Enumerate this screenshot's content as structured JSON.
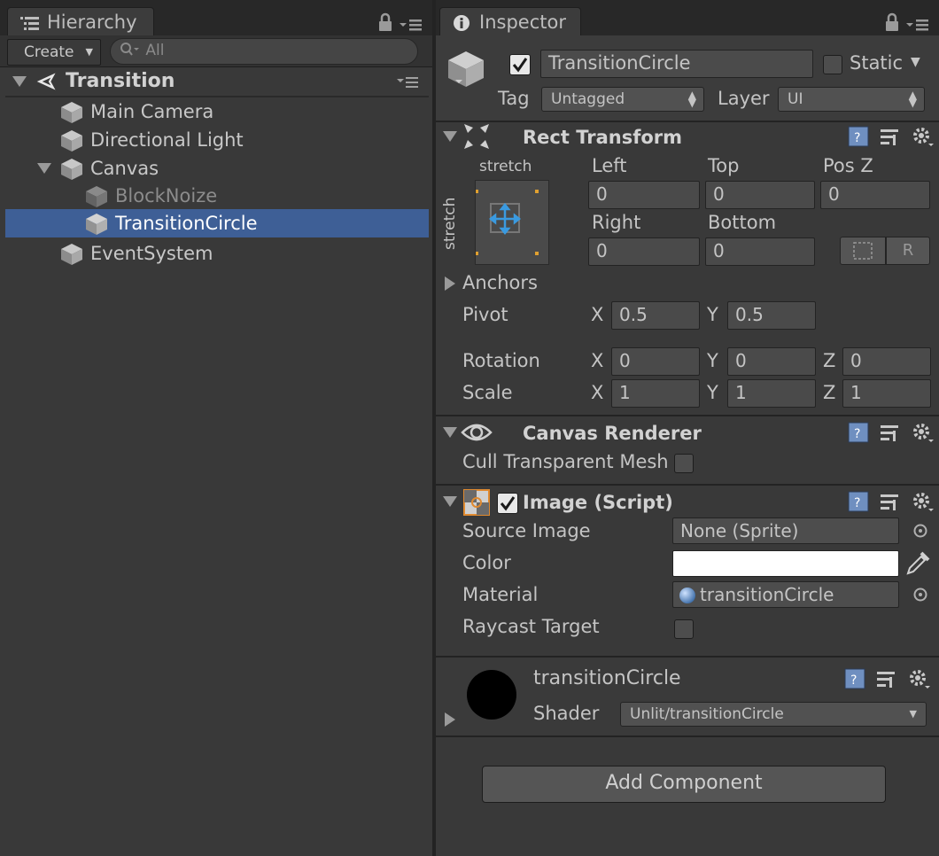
{
  "hierarchy": {
    "tab_label": "Hierarchy",
    "create_label": "Create",
    "search_placeholder": "All",
    "scene_name": "Transition",
    "items": [
      {
        "label": "Main Camera"
      },
      {
        "label": "Directional Light"
      },
      {
        "label": "Canvas"
      },
      {
        "label": "BlockNoize"
      },
      {
        "label": "TransitionCircle"
      },
      {
        "label": "EventSystem"
      }
    ]
  },
  "inspector": {
    "tab_label": "Inspector",
    "object_name": "TransitionCircle",
    "static_label": "Static",
    "tag_label": "Tag",
    "tag_value": "Untagged",
    "layer_label": "Layer",
    "layer_value": "UI",
    "rect_transform": {
      "title": "Rect Transform",
      "anchor_h": "stretch",
      "anchor_v": "stretch",
      "left_label": "Left",
      "left": "0",
      "top_label": "Top",
      "top": "0",
      "posz_label": "Pos Z",
      "posz": "0",
      "right_label": "Right",
      "right": "0",
      "bottom_label": "Bottom",
      "bottom": "0",
      "r_button": "R",
      "anchors_label": "Anchors",
      "pivot_label": "Pivot",
      "pivot_x": "0.5",
      "pivot_y": "0.5",
      "rotation_label": "Rotation",
      "rot_x": "0",
      "rot_y": "0",
      "rot_z": "0",
      "scale_label": "Scale",
      "scale_x": "1",
      "scale_y": "1",
      "scale_z": "1",
      "x": "X",
      "y": "Y",
      "z": "Z"
    },
    "canvas_renderer": {
      "title": "Canvas Renderer",
      "cull_label": "Cull Transparent Mesh"
    },
    "image": {
      "title": "Image (Script)",
      "source_label": "Source Image",
      "source_value": "None (Sprite)",
      "color_label": "Color",
      "color_value": "#ffffff",
      "material_label": "Material",
      "material_value": "transitionCircle",
      "raycast_label": "Raycast Target"
    },
    "material": {
      "name": "transitionCircle",
      "shader_label": "Shader",
      "shader_value": "Unlit/transitionCircle"
    },
    "add_component_label": "Add Component"
  }
}
